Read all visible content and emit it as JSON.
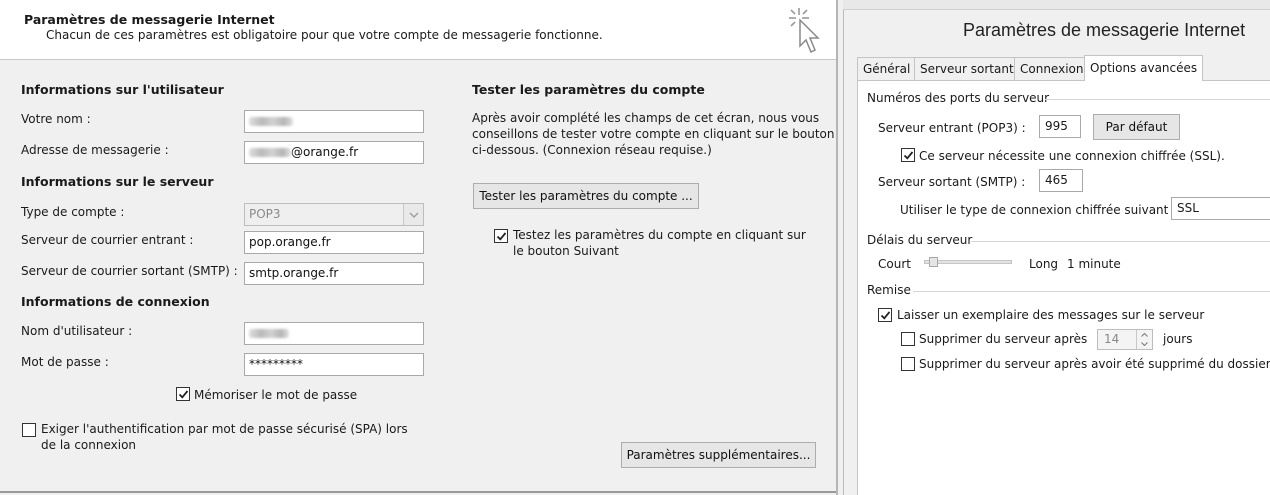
{
  "left": {
    "header": {
      "title": "Paramètres de messagerie Internet",
      "subtitle": "Chacun de ces paramètres est obligatoire pour que votre compte de messagerie fonctionne."
    },
    "user_info": {
      "heading": "Informations sur l'utilisateur",
      "name_label": "Votre nom :",
      "email_label": "Adresse de messagerie :",
      "email_value": "@orange.fr"
    },
    "server_info": {
      "heading": "Informations sur le serveur",
      "account_type_label": "Type de compte :",
      "account_type_value": "POP3",
      "incoming_label": "Serveur de courrier entrant :",
      "incoming_value": "pop.orange.fr",
      "outgoing_label": "Serveur de courrier sortant (SMTP) :",
      "outgoing_value": "smtp.orange.fr"
    },
    "login_info": {
      "heading": "Informations de connexion",
      "username_label": "Nom d'utilisateur :",
      "password_label": "Mot de passe :",
      "password_value": "*********",
      "remember_label": "Mémoriser le mot de passe",
      "spa_label_line1": "Exiger l'authentification par mot de passe sécurisé (SPA) lors",
      "spa_label_line2": "de la connexion"
    },
    "test": {
      "heading": "Tester les paramètres du compte",
      "desc_line1": "Après avoir complété les champs de cet écran, nous vous",
      "desc_line2": "conseillons de tester votre compte en cliquant sur le bouton",
      "desc_line3": "ci-dessous. (Connexion réseau requise.)",
      "button": "Tester les paramètres du compte ...",
      "next_check_line1": "Testez les paramètres du compte en cliquant sur",
      "next_check_line2": "le bouton Suivant",
      "more_button": "Paramètres supplémentaires..."
    }
  },
  "right": {
    "title": "Paramètres de messagerie Internet",
    "tabs": [
      "Général",
      "Serveur sortant",
      "Connexion",
      "Options avancées"
    ],
    "active_tab": "Options avancées",
    "ports": {
      "group": "Numéros des ports du serveur",
      "incoming_label": "Serveur entrant (POP3) :",
      "incoming_value": "995",
      "default_button": "Par défaut",
      "ssl_check": "Ce serveur nécessite une connexion chiffrée (SSL).",
      "outgoing_label": "Serveur sortant (SMTP) :",
      "outgoing_value": "465",
      "encryption_label": "Utiliser le type de connexion chiffrée suivant :",
      "encryption_value": "SSL"
    },
    "timeouts": {
      "group": "Délais du serveur",
      "short": "Court",
      "long": "Long",
      "value": "1 minute"
    },
    "delivery": {
      "group": "Remise",
      "leave_copy": "Laisser un exemplaire des messages sur le serveur",
      "remove_after": "Supprimer du serveur après",
      "days_value": "14",
      "days_label": "jours",
      "remove_deleted": "Supprimer du serveur après avoir été supprimé du dossier Él"
    }
  }
}
